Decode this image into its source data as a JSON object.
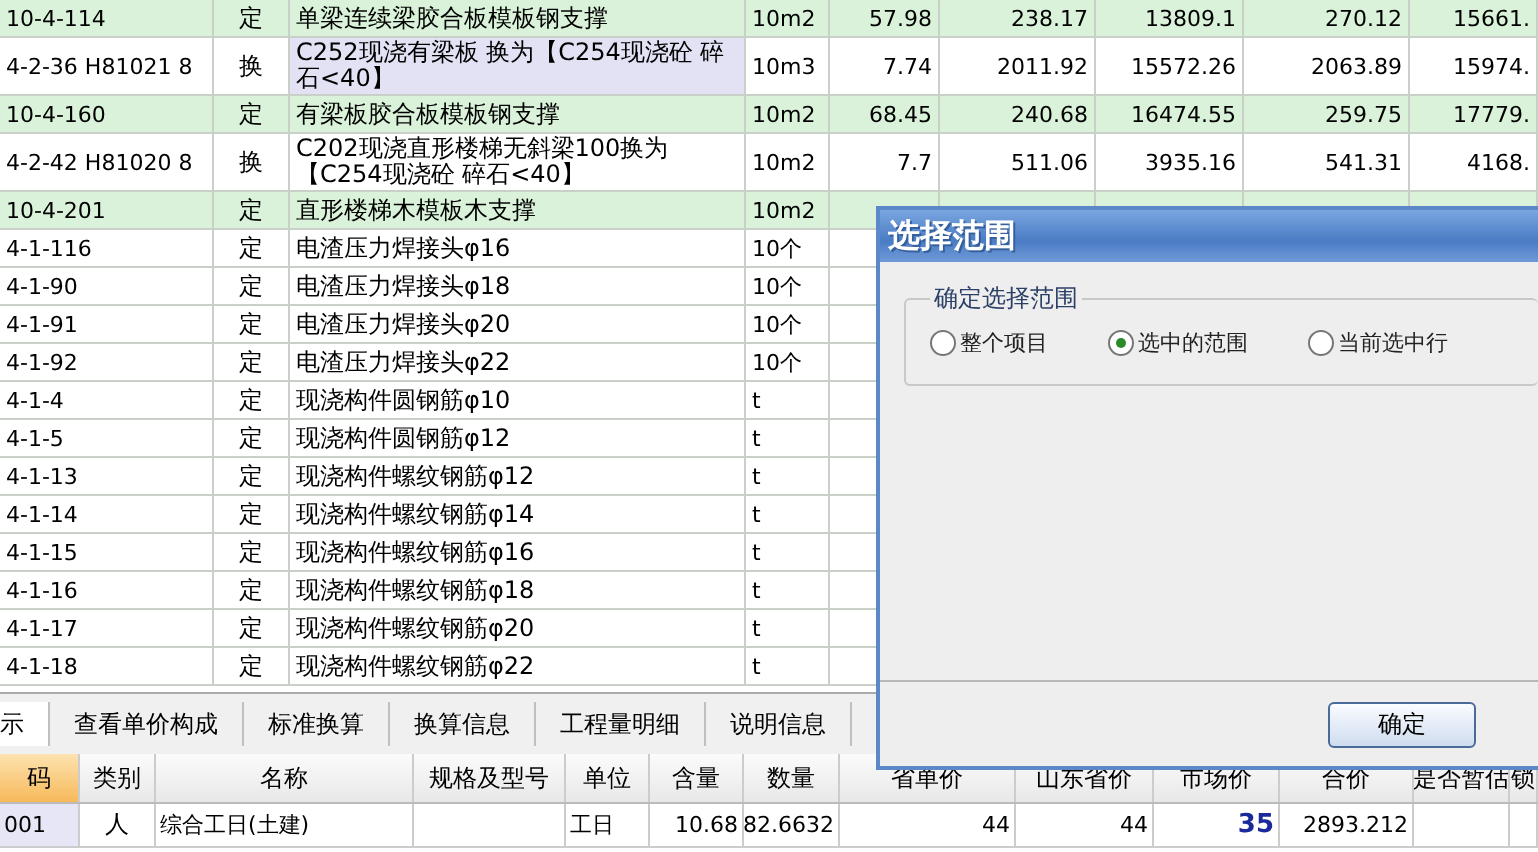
{
  "quota_table": {
    "rows": [
      {
        "code": "10-4-114",
        "type": "定",
        "name": "单梁连续梁胶合板模板钢支撑",
        "unit": "10m2",
        "values": [
          "57.98",
          "238.17",
          "13809.1",
          "270.12",
          "15661."
        ],
        "highlighted": true,
        "selected": false
      },
      {
        "code": "4-2-36 H81021 8",
        "type": "换",
        "name": "C252现浇有梁板 换为【C254现浇砼 碎石<40】",
        "unit": "10m3",
        "values": [
          "7.74",
          "2011.92",
          "15572.26",
          "2063.89",
          "15974."
        ],
        "highlighted": false,
        "selected": true
      },
      {
        "code": "10-4-160",
        "type": "定",
        "name": "有梁板胶合板模板钢支撑",
        "unit": "10m2",
        "values": [
          "68.45",
          "240.68",
          "16474.55",
          "259.75",
          "17779."
        ],
        "highlighted": true,
        "selected": false
      },
      {
        "code": "4-2-42 H81020 8",
        "type": "换",
        "name": "C202现浇直形楼梯无斜梁100换为【C254现浇砼 碎石<40】",
        "unit": "10m2",
        "values": [
          "7.7",
          "511.06",
          "3935.16",
          "541.31",
          "4168."
        ],
        "highlighted": false,
        "selected": false
      },
      {
        "code": "10-4-201",
        "type": "定",
        "name": "直形楼梯木模板木支撑",
        "unit": "10m2",
        "values": [],
        "highlighted": true,
        "selected": false
      },
      {
        "code": "4-1-116",
        "type": "定",
        "name": "电渣压力焊接头φ16",
        "unit": "10个",
        "values": [],
        "highlighted": false,
        "selected": false
      },
      {
        "code": "4-1-90",
        "type": "定",
        "name": "电渣压力焊接头φ18",
        "unit": "10个",
        "values": [],
        "highlighted": false,
        "selected": false
      },
      {
        "code": "4-1-91",
        "type": "定",
        "name": "电渣压力焊接头φ20",
        "unit": "10个",
        "values": [],
        "highlighted": false,
        "selected": false
      },
      {
        "code": "4-1-92",
        "type": "定",
        "name": "电渣压力焊接头φ22",
        "unit": "10个",
        "values": [],
        "highlighted": false,
        "selected": false
      },
      {
        "code": "4-1-4",
        "type": "定",
        "name": "现浇构件圆钢筋φ10",
        "unit": "t",
        "values": [],
        "highlighted": false,
        "selected": false
      },
      {
        "code": "4-1-5",
        "type": "定",
        "name": "现浇构件圆钢筋φ12",
        "unit": "t",
        "values": [],
        "highlighted": false,
        "selected": false
      },
      {
        "code": "4-1-13",
        "type": "定",
        "name": "现浇构件螺纹钢筋φ12",
        "unit": "t",
        "values": [],
        "highlighted": false,
        "selected": false
      },
      {
        "code": "4-1-14",
        "type": "定",
        "name": "现浇构件螺纹钢筋φ14",
        "unit": "t",
        "values": [],
        "highlighted": false,
        "selected": false
      },
      {
        "code": "4-1-15",
        "type": "定",
        "name": "现浇构件螺纹钢筋φ16",
        "unit": "t",
        "values": [],
        "highlighted": false,
        "selected": false
      },
      {
        "code": "4-1-16",
        "type": "定",
        "name": "现浇构件螺纹钢筋φ18",
        "unit": "t",
        "values": [],
        "highlighted": false,
        "selected": false
      },
      {
        "code": "4-1-17",
        "type": "定",
        "name": "现浇构件螺纹钢筋φ20",
        "unit": "t",
        "values": [],
        "highlighted": false,
        "selected": false
      },
      {
        "code": "4-1-18",
        "type": "定",
        "name": "现浇构件螺纹钢筋φ22",
        "unit": "t",
        "values": [],
        "highlighted": false,
        "selected": false
      }
    ]
  },
  "detail_tabs": [
    {
      "label": "示",
      "selected": true
    },
    {
      "label": "查看单价构成",
      "selected": false
    },
    {
      "label": "标准换算",
      "selected": false
    },
    {
      "label": "换算信息",
      "selected": false
    },
    {
      "label": "工程量明细",
      "selected": false
    },
    {
      "label": "说明信息",
      "selected": false
    }
  ],
  "detail_table": {
    "columns": [
      {
        "label": "码",
        "selected": true
      },
      {
        "label": "类别",
        "selected": false
      },
      {
        "label": "名称",
        "selected": false
      },
      {
        "label": "规格及型号",
        "selected": false
      },
      {
        "label": "单位",
        "selected": false
      },
      {
        "label": "含量",
        "selected": false
      },
      {
        "label": "数量",
        "selected": false
      },
      {
        "label": "省单价",
        "selected": false
      },
      {
        "label": "山东省价",
        "selected": false
      },
      {
        "label": "市场价",
        "selected": false
      },
      {
        "label": "合价",
        "selected": false
      },
      {
        "label": "是否暂估",
        "selected": false
      },
      {
        "label": "锁",
        "selected": false
      }
    ],
    "rows": [
      {
        "cells": [
          {
            "kind": "code",
            "text": "001"
          },
          {
            "kind": "center",
            "text": "人"
          },
          {
            "kind": "text",
            "text": "综合工日(土建)"
          },
          {
            "kind": "blank"
          },
          {
            "kind": "text",
            "text": "工日"
          },
          {
            "kind": "number",
            "text": "10.68"
          },
          {
            "kind": "number",
            "text": "82.6632"
          },
          {
            "kind": "number",
            "text": "44"
          },
          {
            "kind": "number",
            "text": "44"
          },
          {
            "kind": "price",
            "text": "35"
          },
          {
            "kind": "number",
            "text": "2893.212"
          },
          {
            "kind": "blank"
          },
          {
            "kind": "blank"
          }
        ]
      }
    ]
  },
  "dialog": {
    "title": "选择范围",
    "group_label": "确定选择范围",
    "options": [
      {
        "label": "整个项目",
        "selected": false
      },
      {
        "label": "选中的范围",
        "selected": true
      },
      {
        "label": "当前选中行",
        "selected": false
      }
    ],
    "buttons": [
      "确定"
    ]
  }
}
